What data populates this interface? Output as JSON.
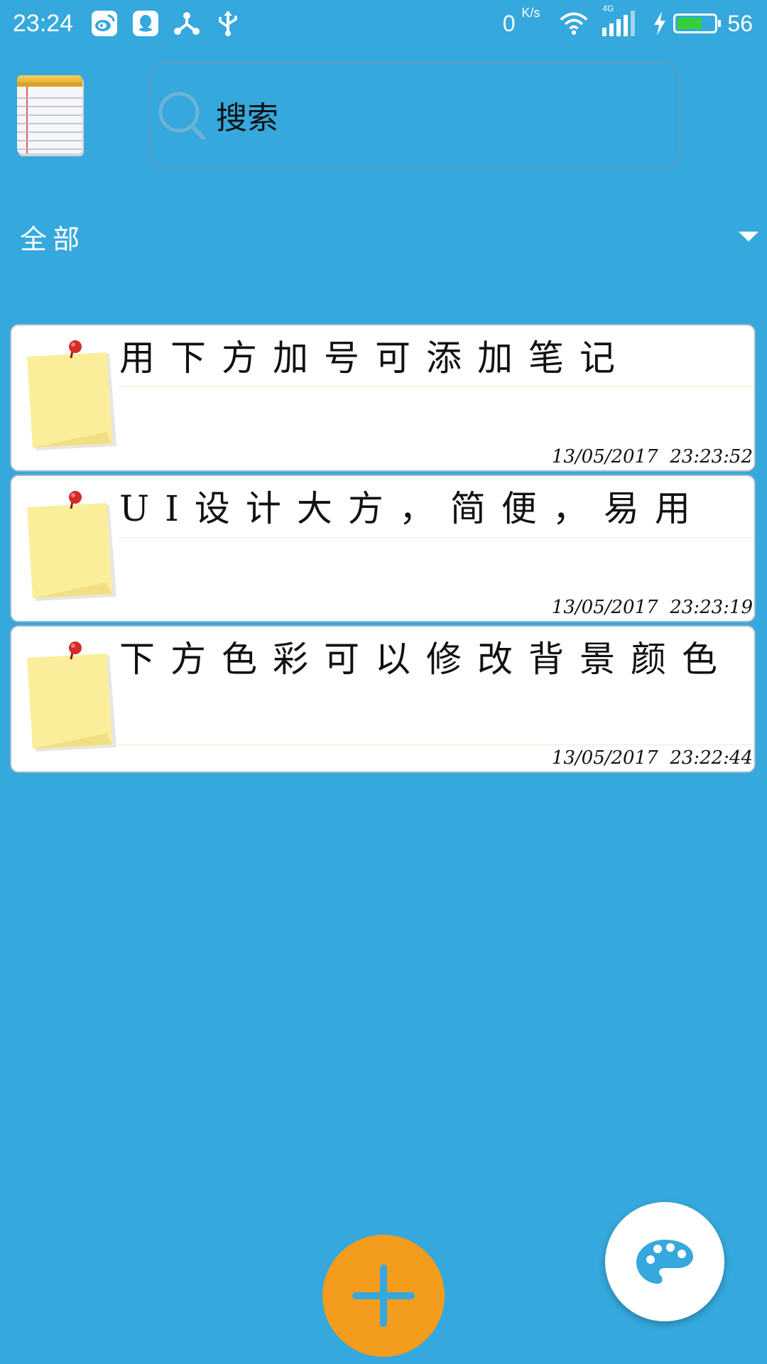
{
  "status_bar": {
    "time": "23:24",
    "net_speed": "0",
    "net_speed_unit": "K/s",
    "network_type": "4G",
    "battery_level": "56",
    "icons": [
      "weibo-icon",
      "qq-icon",
      "share-icon",
      "usb-icon",
      "wifi-icon",
      "signal-icon",
      "charging-icon",
      "battery-icon"
    ]
  },
  "header": {
    "logo_icon": "notepad-icon",
    "search_placeholder": "搜索"
  },
  "category": {
    "selected": "全部"
  },
  "notes": [
    {
      "text": "用下方加号可添加笔记",
      "date": "13/05/2017",
      "time": "23:23:52"
    },
    {
      "text": "UI设计大方，简便，易用",
      "date": "13/05/2017",
      "time": "23:23:19"
    },
    {
      "text": "下方色彩可以修改背景颜色",
      "date": "13/05/2017",
      "time": "23:22:44"
    }
  ],
  "colors": {
    "background": "#35a8dd",
    "add_button": "#f39c1e",
    "palette_icon": "#35a8dd",
    "note_sticky": "#fbee9a"
  }
}
